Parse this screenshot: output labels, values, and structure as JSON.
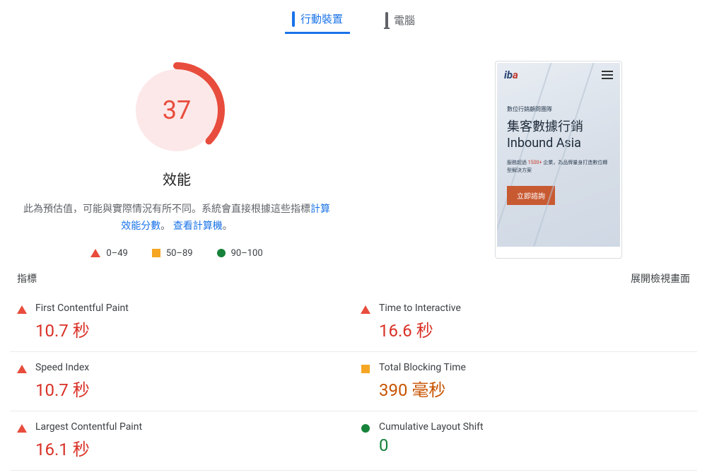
{
  "tabs": {
    "mobile": "行動裝置",
    "desktop": "電腦"
  },
  "score": {
    "value": "37",
    "title": "效能",
    "description_prefix": "此為預估值，可能與實際情況有所不同。系統會直接根據這些指標",
    "link_calc": "計算效能分數",
    "period": "。",
    "link_calc2": "查看計算機",
    "period2": "。",
    "color": "#e84c3d",
    "percent": 37
  },
  "legend": {
    "r1": "0–49",
    "r2": "50–89",
    "r3": "90–100"
  },
  "preview": {
    "logo_left": "i",
    "logo_mid": "b",
    "logo_right": "a",
    "subtitle": "數位行銷顧問團隊",
    "title_line1": "集客數據行銷",
    "title_line2": "Inbound Asia",
    "desc_prefix": "服務超過 ",
    "desc_highlight": "1500+",
    "desc_suffix": " 企業，為品牌量身打造數位轉型解決方案",
    "cta": "立即諮詢"
  },
  "metrics_header": {
    "label": "指標",
    "expand": "展開檢視畫面"
  },
  "metrics": [
    {
      "label": "First Contentful Paint",
      "value": "10.7 秒",
      "status": "red"
    },
    {
      "label": "Time to Interactive",
      "value": "16.6 秒",
      "status": "red"
    },
    {
      "label": "Speed Index",
      "value": "10.7 秒",
      "status": "red"
    },
    {
      "label": "Total Blocking Time",
      "value": "390 毫秒",
      "status": "orange"
    },
    {
      "label": "Largest Contentful Paint",
      "value": "16.1 秒",
      "status": "red"
    },
    {
      "label": "Cumulative Layout Shift",
      "value": "0",
      "status": "green"
    }
  ],
  "colors": {
    "red": "#d93025",
    "orange": "#c85300",
    "green": "#178239"
  }
}
